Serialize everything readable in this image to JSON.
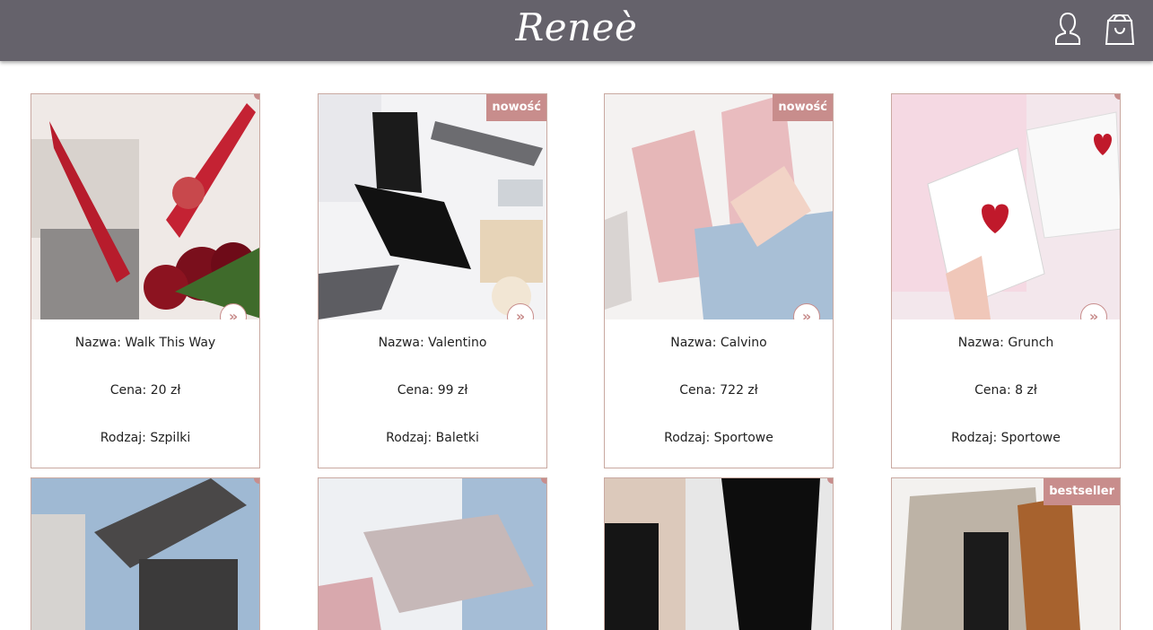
{
  "header": {
    "logo": "Reneè",
    "account_icon": "user-icon",
    "cart_icon": "shopping-bag-icon",
    "background": "#65626b"
  },
  "labels": {
    "name": "Nazwa",
    "price": "Cena",
    "type": "Rodzaj"
  },
  "accent_color": "#c88d8c",
  "products": [
    {
      "name": "Walk This Way",
      "price": "20 zł",
      "type": "Szpilki",
      "badge": ""
    },
    {
      "name": "Valentino",
      "price": "99 zł",
      "type": "Baletki",
      "badge": "nowość"
    },
    {
      "name": "Calvino",
      "price": "722 zł",
      "type": "Sportowe",
      "badge": "nowość"
    },
    {
      "name": "Grunch",
      "price": "8 zł",
      "type": "Sportowe",
      "badge": ""
    },
    {
      "badge": ""
    },
    {
      "badge": ""
    },
    {
      "badge": ""
    },
    {
      "badge": "bestseller"
    }
  ],
  "more_icon": "double-chevron-right-icon"
}
